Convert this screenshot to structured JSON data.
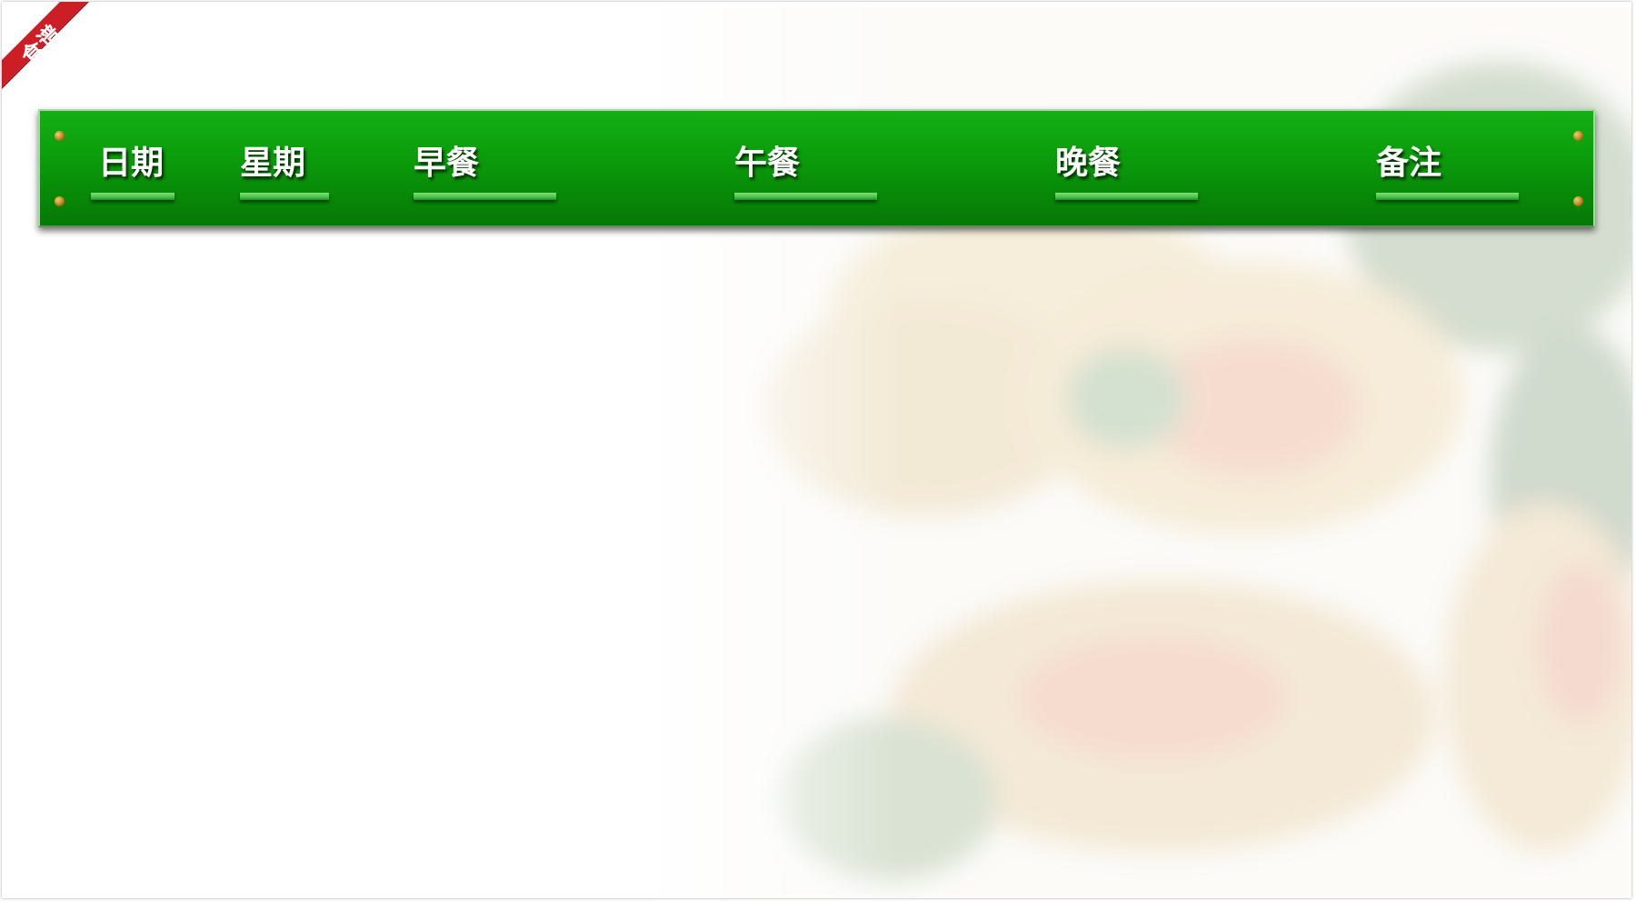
{
  "ribbon": {
    "label": "食谱"
  },
  "header": {
    "columns": [
      {
        "label": "日期"
      },
      {
        "label": "星期"
      },
      {
        "label": "早餐"
      },
      {
        "label": "午餐"
      },
      {
        "label": "晚餐"
      },
      {
        "label": "备注"
      }
    ]
  },
  "colors": {
    "ribbon": "#cc1f25",
    "header_green": "#0a9a0a",
    "underline_green": "#46c446"
  }
}
